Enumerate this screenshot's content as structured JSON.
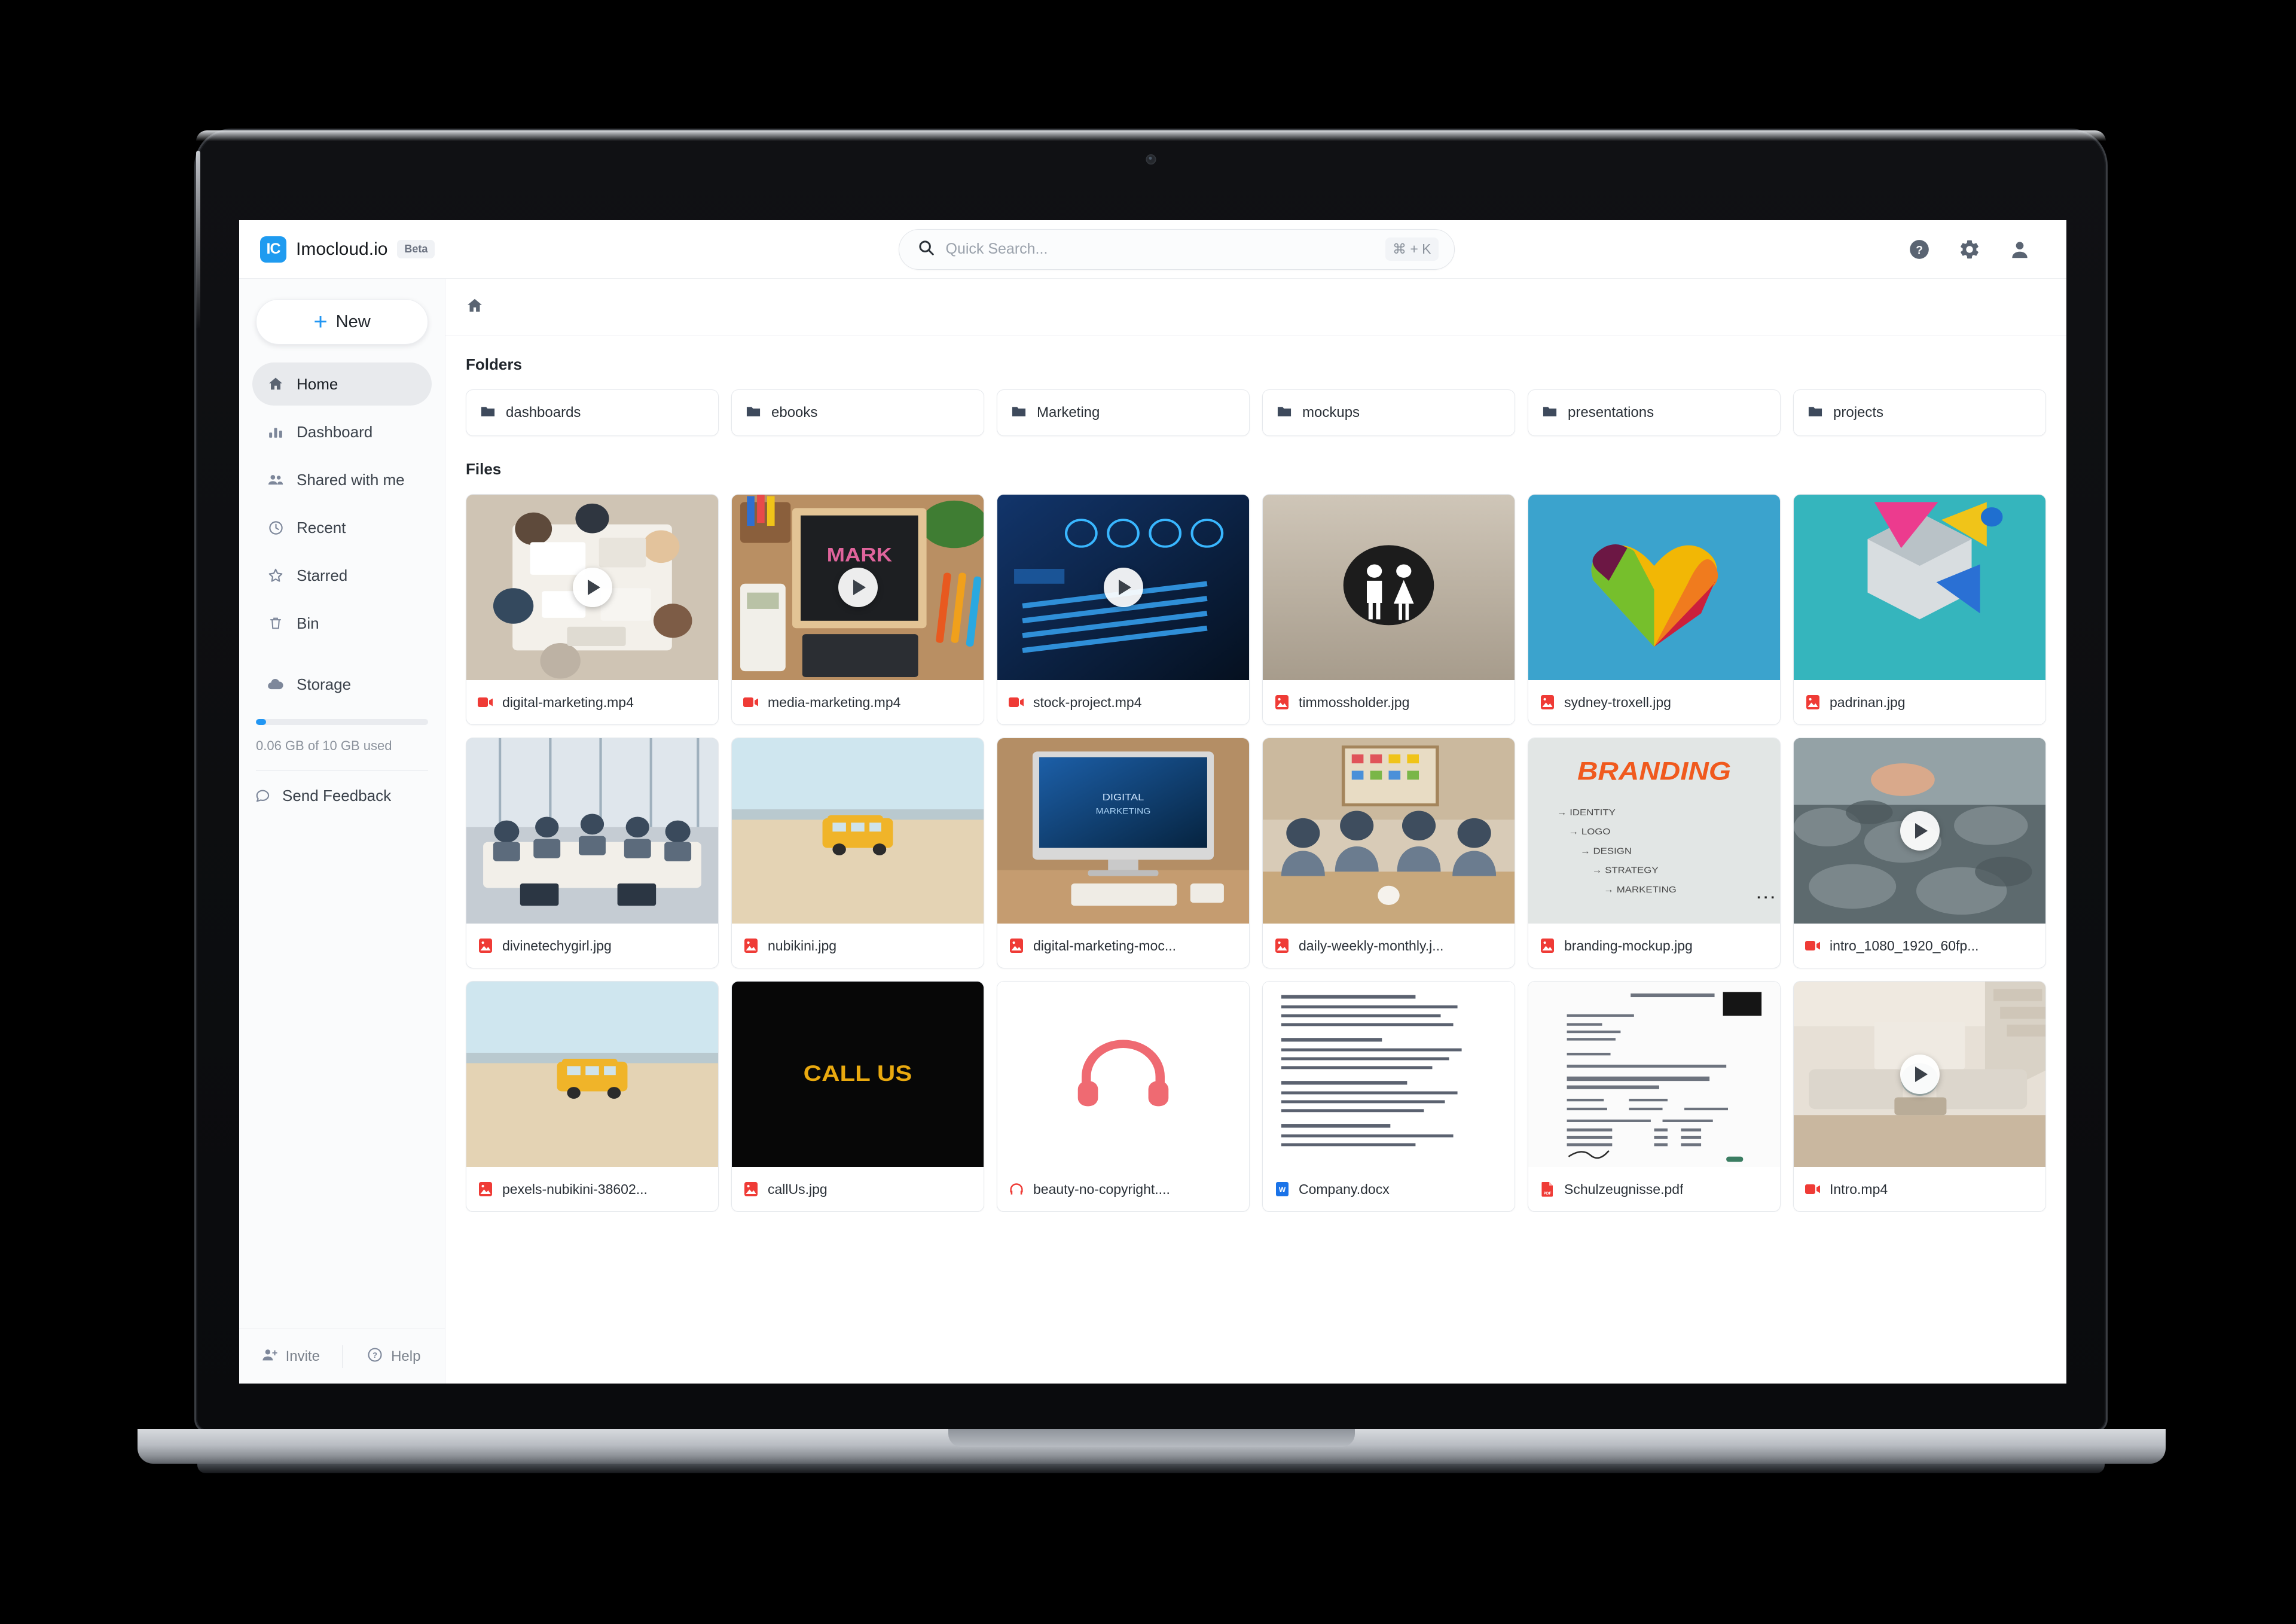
{
  "app": {
    "brand_logo_text": "IC",
    "brand_name": "Imocloud.io",
    "brand_badge": "Beta",
    "accent_color": "#2196f3"
  },
  "search": {
    "placeholder": "Quick Search...",
    "shortcut": "⌘ + K"
  },
  "topbar_icons": [
    {
      "name": "help-icon",
      "label": "Help"
    },
    {
      "name": "settings-icon",
      "label": "Settings"
    },
    {
      "name": "account-icon",
      "label": "Account"
    }
  ],
  "sidebar": {
    "new_button": "New",
    "items": [
      {
        "label": "Home",
        "icon": "home-icon",
        "active": true
      },
      {
        "label": "Dashboard",
        "icon": "chart-icon",
        "active": false
      },
      {
        "label": "Shared with me",
        "icon": "people-icon",
        "active": false
      },
      {
        "label": "Recent",
        "icon": "clock-icon",
        "active": false
      },
      {
        "label": "Starred",
        "icon": "star-icon",
        "active": false
      },
      {
        "label": "Bin",
        "icon": "trash-icon",
        "active": false
      },
      {
        "label": "Storage",
        "icon": "cloud-icon",
        "active": false
      }
    ],
    "storage_text": "0.06 GB of 10 GB used",
    "storage_percent": 6,
    "feedback": "Send Feedback",
    "footer": {
      "invite": "Invite",
      "help": "Help"
    }
  },
  "main": {
    "breadcrumb_icon": "home-icon",
    "folders_title": "Folders",
    "files_title": "Files",
    "folders": [
      {
        "name": "dashboards"
      },
      {
        "name": "ebooks"
      },
      {
        "name": "Marketing"
      },
      {
        "name": "mockups"
      },
      {
        "name": "presentations"
      },
      {
        "name": "projects"
      }
    ],
    "files": [
      {
        "name": "digital-marketing.mp4",
        "type": "video",
        "icon": "video-icon",
        "thumb": "desk-team",
        "play": true
      },
      {
        "name": "media-marketing.mp4",
        "type": "video",
        "icon": "video-icon",
        "thumb": "mark-chalkboard",
        "play": true
      },
      {
        "name": "stock-project.mp4",
        "type": "video",
        "icon": "video-icon",
        "thumb": "blue-charts",
        "play": true
      },
      {
        "name": "timmossholder.jpg",
        "type": "image",
        "icon": "image-icon",
        "thumb": "restroom-sign",
        "play": false
      },
      {
        "name": "sydney-troxell.jpg",
        "type": "image",
        "icon": "image-icon",
        "thumb": "candy-heart",
        "play": false
      },
      {
        "name": "padrinan.jpg",
        "type": "image",
        "icon": "image-icon",
        "thumb": "teal-shapes",
        "play": false
      },
      {
        "name": "divinetechygirl.jpg",
        "type": "image",
        "icon": "image-icon",
        "thumb": "meeting-room",
        "play": false
      },
      {
        "name": "nubikini.jpg",
        "type": "image",
        "icon": "image-icon",
        "thumb": "beach-bus",
        "play": false
      },
      {
        "name": "digital-marketing-moc...",
        "type": "image",
        "icon": "image-icon",
        "thumb": "imac-desk",
        "play": false
      },
      {
        "name": "daily-weekly-monthly.j...",
        "type": "image",
        "icon": "image-icon",
        "thumb": "team-table",
        "play": false
      },
      {
        "name": "branding-mockup.jpg",
        "type": "image",
        "icon": "image-icon",
        "thumb": "branding-board",
        "play": false
      },
      {
        "name": "intro_1080_1920_60fp...",
        "type": "video",
        "icon": "video-icon",
        "thumb": "rocks-water",
        "play": true
      },
      {
        "name": "pexels-nubikini-38602...",
        "type": "image",
        "icon": "image-icon",
        "thumb": "beach-bus",
        "play": false
      },
      {
        "name": "callUs.jpg",
        "type": "image",
        "icon": "image-icon",
        "thumb": "call-us",
        "play": false
      },
      {
        "name": "beauty-no-copyright....",
        "type": "audio",
        "icon": "headphones-icon",
        "thumb": "headphones",
        "play": false
      },
      {
        "name": "Company.docx",
        "type": "doc",
        "icon": "word-icon",
        "thumb": "doc-page",
        "play": false
      },
      {
        "name": "Schulzeugnisse.pdf",
        "type": "pdf",
        "icon": "pdf-icon",
        "thumb": "certificate",
        "play": false
      },
      {
        "name": "Intro.mp4",
        "type": "video",
        "icon": "video-icon",
        "thumb": "interior-room",
        "play": true
      }
    ],
    "thumb_text": {
      "mark": "MARK",
      "call_us": "CALL US",
      "branding_title": "BRANDING",
      "branding_items": [
        "IDENTITY",
        "LOGO",
        "DESIGN",
        "STRATEGY",
        "MARKETING"
      ]
    }
  }
}
